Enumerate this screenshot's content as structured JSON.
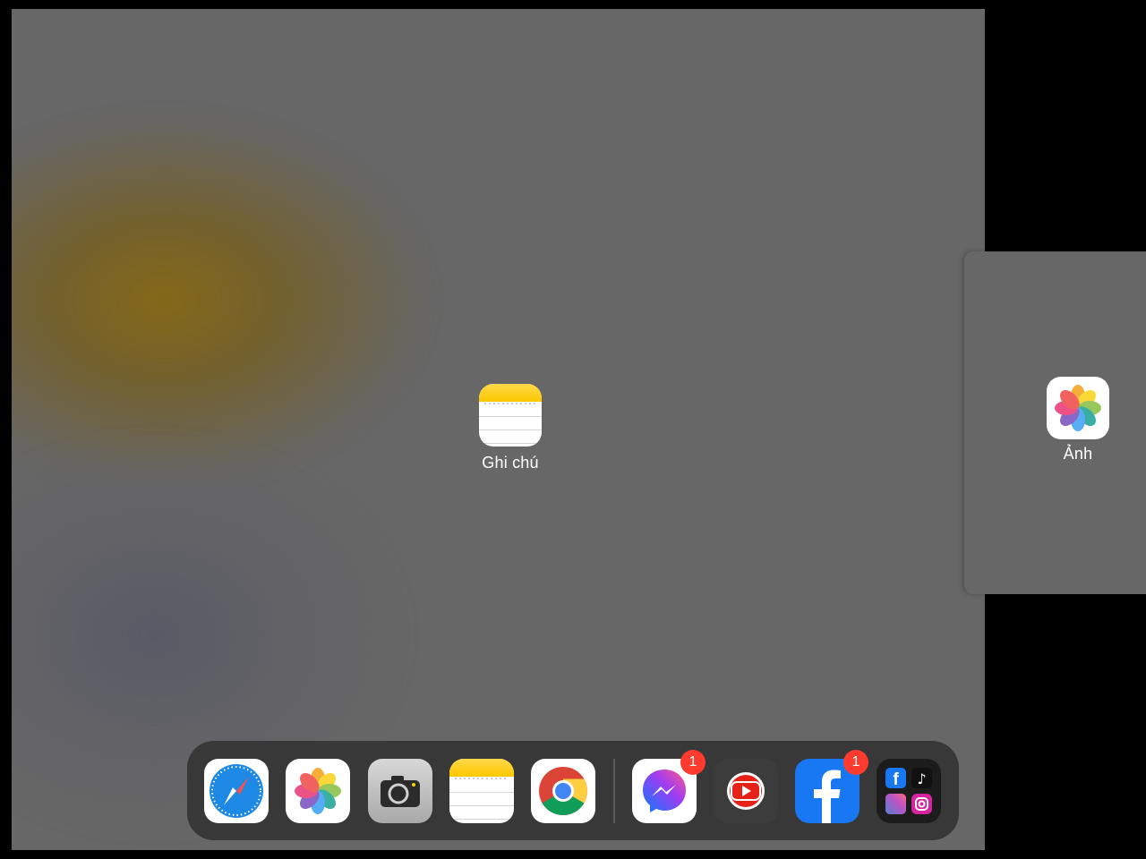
{
  "center_app": {
    "label": "Ghi chú",
    "icon": "notes-icon"
  },
  "side_app": {
    "label": "Ảnh",
    "icon": "photos-icon"
  },
  "dock": {
    "apps": [
      {
        "name": "safari",
        "icon": "safari-icon"
      },
      {
        "name": "photos",
        "icon": "photos-icon"
      },
      {
        "name": "camera",
        "icon": "camera-icon"
      },
      {
        "name": "notes",
        "icon": "notes-icon"
      },
      {
        "name": "chrome",
        "icon": "chrome-icon"
      },
      {
        "name": "messenger",
        "icon": "messenger-icon",
        "badge": "1"
      },
      {
        "name": "youtube",
        "icon": "youtube-icon"
      },
      {
        "name": "facebook",
        "icon": "facebook-icon",
        "badge": "1"
      },
      {
        "name": "app-library",
        "icon": "app-library-icon"
      }
    ]
  },
  "colors": {
    "badge": "#ff3b30",
    "notes_yellow": "#fcc800",
    "facebook_blue": "#1877f2",
    "messenger_purple": "#a33bf0"
  }
}
